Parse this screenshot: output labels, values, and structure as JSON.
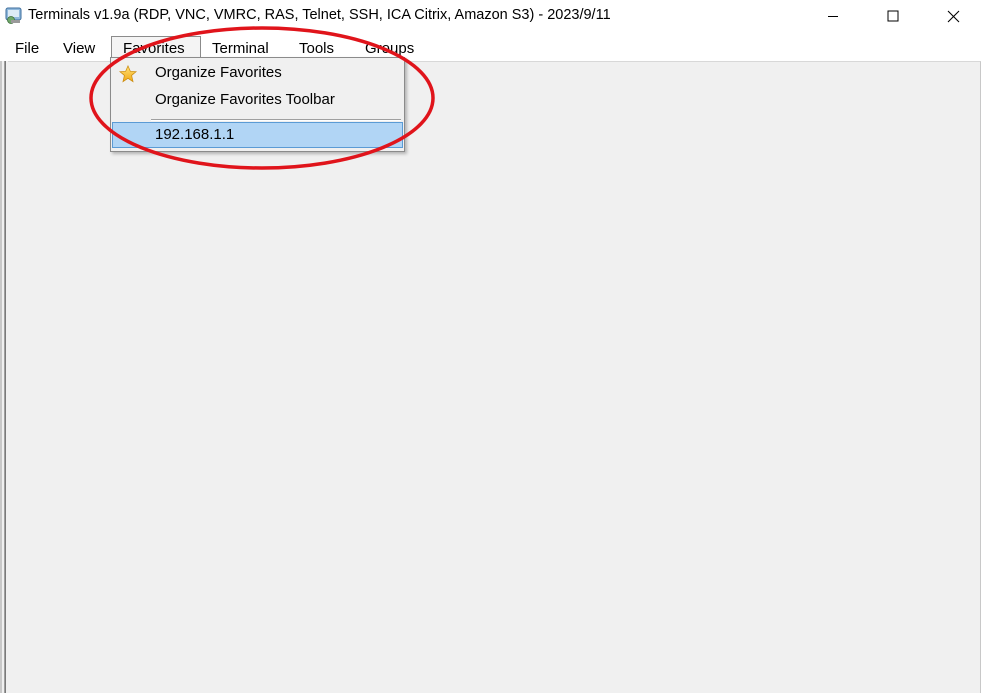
{
  "window": {
    "title": "Terminals v1.9a (RDP, VNC, VMRC, RAS, Telnet, SSH, ICA Citrix, Amazon S3) - 2023/9/11",
    "icon": "terminals-app-icon"
  },
  "window_controls": {
    "minimize_icon": "minimize-icon",
    "maximize_icon": "maximize-icon",
    "close_icon": "close-icon"
  },
  "menubar": {
    "items": [
      {
        "label": "File"
      },
      {
        "label": "View"
      },
      {
        "label": "Favorites"
      },
      {
        "label": "Terminal"
      },
      {
        "label": "Tools"
      },
      {
        "label": "Groups"
      }
    ],
    "open_menu": "Favorites"
  },
  "favorites_menu": {
    "items": [
      {
        "label": "Organize Favorites",
        "icon": "star-icon"
      },
      {
        "label": "Organize Favorites Toolbar"
      },
      {
        "label": "192.168.1.1",
        "highlighted": true
      }
    ]
  },
  "colors": {
    "annotation_circle": "#e0141b",
    "highlight_bg": "#b1d5f5",
    "client_bg": "#f0f0f0"
  }
}
